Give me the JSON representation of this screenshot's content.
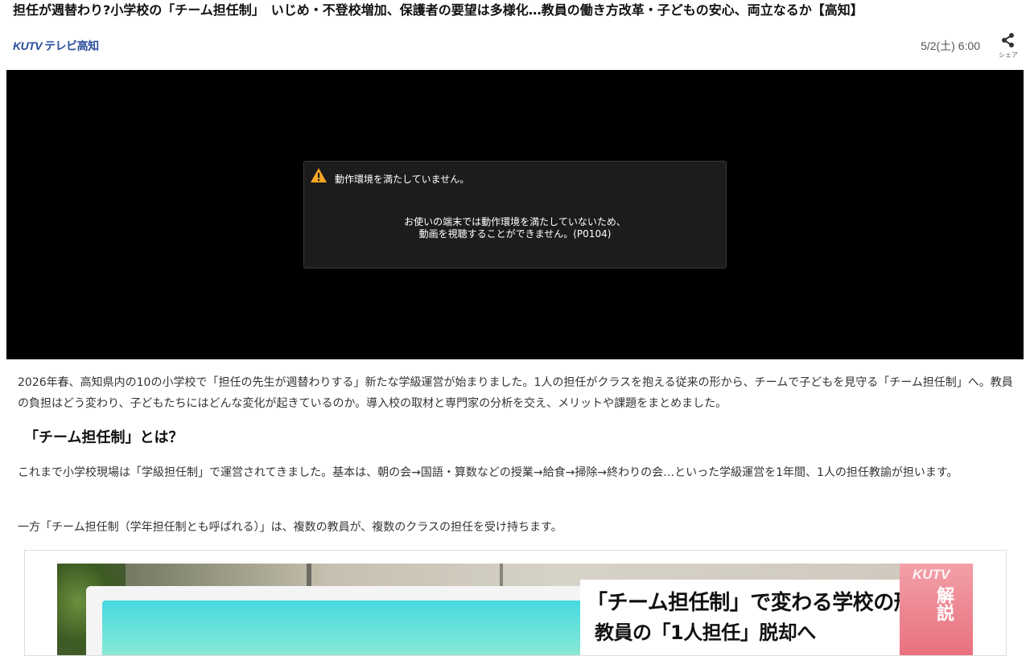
{
  "article": {
    "headline": "担任が週替わり?小学校の「チーム担任制」　いじめ・不登校増加、保護者の要望は多様化…教員の働き方改革・子どもの安心、両立なるか【高知】",
    "source_brand": "KUTV",
    "source_channel": "テレビ高知",
    "date": "5/2(土) 6:00",
    "share_label": "シェア",
    "share_icon": "share-icon"
  },
  "video": {
    "error_icon": "warning-icon",
    "warning_color": "#f5a623",
    "error_title": "動作環境を満たしていません。",
    "error_line1": "お使いの端末では動作環境を満たしていないため、",
    "error_line2": "動画を視聴することができません。(P0104)"
  },
  "body": {
    "paragraph1": "2026年春、高知県内の10の小学校で「担任の先生が週替わりする」新たな学級運営が始まりました。1人の担任がクラスを抱える従来の形から、チームで子どもを見守る「チーム担任制」へ。教員の負担はどう変わり、子どもたちにはどんな変化が起きているのか。導入校の取材と専門家の分析を交え、メリットや課題をまとめました。",
    "section_heading": "「チーム担任制」とは？",
    "paragraph2": "これまで小学校現場は「学級担任制」で運営されてきました。基本は、朝の会→国語・算数などの授業→給食→掃除→終わりの会…といった学級運営を1年間、1人の担任教諭が担います。",
    "paragraph3": "一方「チーム担任制（学年担任制とも呼ばれる）」は、複数の教員が、複数のクラスの担任を受け持ちます。"
  },
  "figure": {
    "caption_line1": "「チーム担任制」で変わる学校の形",
    "caption_line2": "教員の「1人担任」脱却へ",
    "badge_brand": "KUTV",
    "badge_text": "解説"
  }
}
